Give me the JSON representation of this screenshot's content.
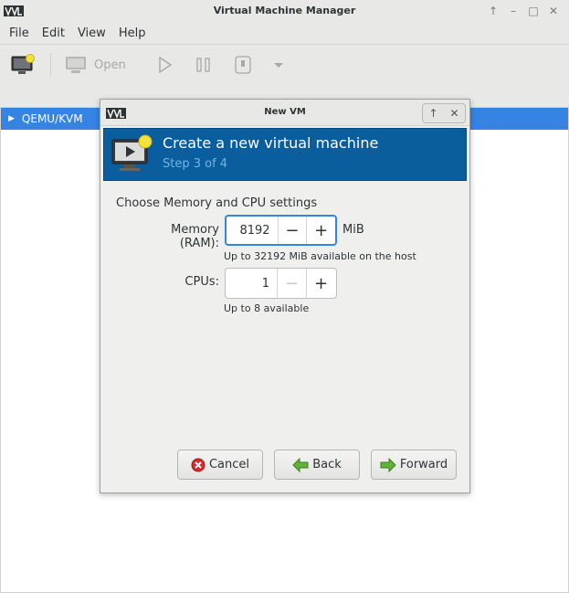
{
  "window": {
    "title": "Virtual Machine Manager"
  },
  "menu": {
    "items": [
      "File",
      "Edit",
      "View",
      "Help"
    ]
  },
  "toolbar": {
    "open_label": "Open"
  },
  "connections": {
    "items": [
      {
        "label": "QEMU/KVM"
      }
    ]
  },
  "dialog": {
    "title": "New VM",
    "heading": "Create a new virtual machine",
    "step": "Step 3 of 4",
    "section_title": "Choose Memory and CPU settings",
    "memory": {
      "label": "Memory (RAM):",
      "value": "8192",
      "unit": "MiB",
      "hint": "Up to 32192 MiB available on the host"
    },
    "cpus": {
      "label": "CPUs:",
      "value": "1",
      "hint": "Up to 8 available"
    },
    "buttons": {
      "cancel": "Cancel",
      "back": "Back",
      "forward": "Forward"
    }
  },
  "colors": {
    "banner": "#0a5e9d",
    "selection": "#3584e4",
    "step_text": "#6fb5e8"
  }
}
